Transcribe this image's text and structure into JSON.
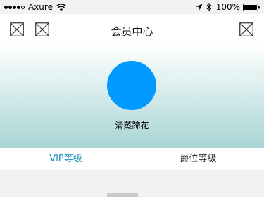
{
  "status_bar": {
    "carrier": "Axure",
    "battery": "100%",
    "signal_bars_filled": 4,
    "signal_bars_total": 5
  },
  "nav": {
    "title": "会员中心",
    "left_icons": [
      "image-placeholder-icon",
      "image-placeholder-icon"
    ],
    "right_icon": "image-placeholder-icon"
  },
  "profile": {
    "username": "清蒸蹄花",
    "avatar_color": "#0099ff"
  },
  "tabs": [
    {
      "label": "VIP等级",
      "active": true
    },
    {
      "label": "爵位等级",
      "active": false
    }
  ],
  "colors": {
    "accent": "#1a8fb5",
    "tab_inactive": "#333333",
    "gradient_bottom": "#a8d4d4"
  }
}
